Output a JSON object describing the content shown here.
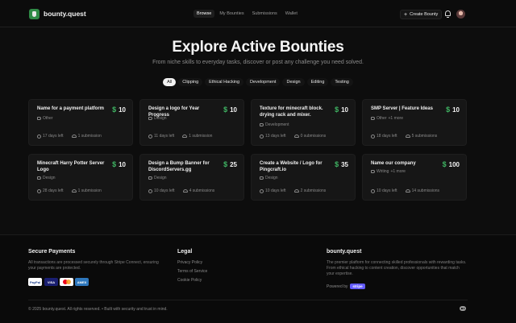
{
  "nav": {
    "brand": "bounty.quest",
    "links": [
      "Browse",
      "My Bounties",
      "Submissions",
      "Wallet"
    ],
    "create_label": "Create Bounty"
  },
  "hero": {
    "title": "Explore Active Bounties",
    "subtitle": "From niche skills to everyday tasks, discover or post any challenge you need solved."
  },
  "filters": [
    "All",
    "Clipping",
    "Ethical Hacking",
    "Development",
    "Design",
    "Editing",
    "Testing"
  ],
  "currency_symbol": "$",
  "cards": [
    {
      "title": "Name for a payment platform",
      "price": "10",
      "tag": "Other",
      "tag_extra": "",
      "time": "17 days left",
      "subs": "1 submission"
    },
    {
      "title": "Design a logo for Year Progress",
      "price": "10",
      "tag": "Design",
      "tag_extra": "",
      "time": "11 days left",
      "subs": "1 submission"
    },
    {
      "title": "Texture for minecraft block. drying rack and mixer.",
      "price": "10",
      "tag": "Development",
      "tag_extra": "",
      "time": "13 days left",
      "subs": "0 submissions"
    },
    {
      "title": "SMP Server | Feature Ideas",
      "price": "10",
      "tag": "Other",
      "tag_extra": "+1 more",
      "time": "18 days left",
      "subs": "5 submissions"
    },
    {
      "title": "Minecraft Harry Potter Server Logo",
      "price": "10",
      "tag": "Design",
      "tag_extra": "",
      "time": "28 days left",
      "subs": "1 submission"
    },
    {
      "title": "Design a Bump Banner for DiscordServers.gg",
      "price": "25",
      "tag": "Design",
      "tag_extra": "",
      "time": "10 days left",
      "subs": "4 submissions"
    },
    {
      "title": "Create a Website / Logo for Pingcraft.io",
      "price": "35",
      "tag": "Design",
      "tag_extra": "",
      "time": "10 days left",
      "subs": "2 submissions"
    },
    {
      "title": "Name our company",
      "price": "100",
      "tag": "Writing",
      "tag_extra": "+1 more",
      "time": "10 days left",
      "subs": "14 submissions"
    }
  ],
  "footer": {
    "secure_title": "Secure Payments",
    "secure_text": "All transactions are processed securely through Stripe Connect, ensuring your payments are protected.",
    "payment_methods": [
      "PayPal",
      "VISA",
      "",
      "AMEX"
    ],
    "legal_title": "Legal",
    "legal_links": [
      "Privacy Policy",
      "Terms of Service",
      "Cookie Policy"
    ],
    "brand_title": "bounty.quest",
    "brand_text": "The premier platform for connecting skilled professionals with rewarding tasks. From ethical hacking to content creation, discover opportunities that match your expertise.",
    "powered_by": "Powered by",
    "stripe": "stripe",
    "copyright": "© 2025 bounty.quest. All rights reserved.  •  Built with security and trust in mind."
  }
}
